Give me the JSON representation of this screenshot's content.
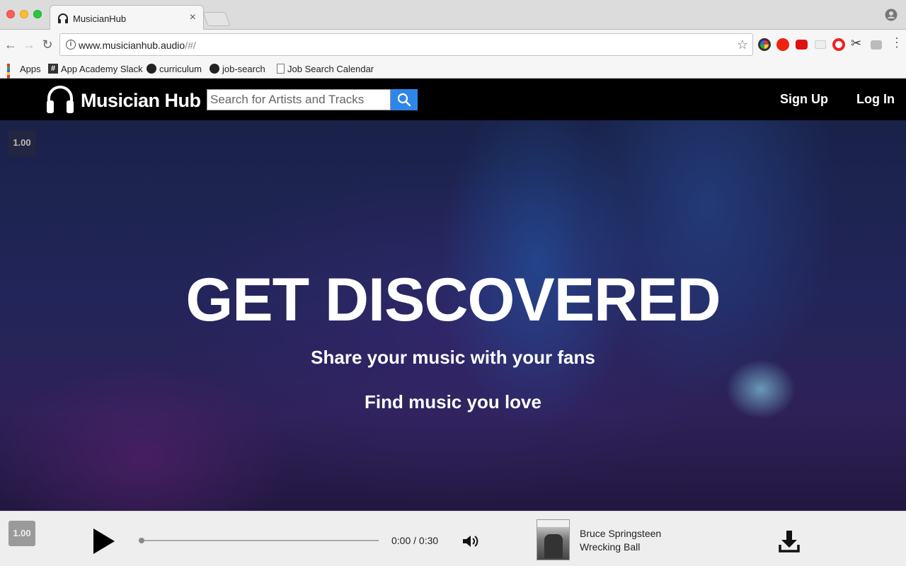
{
  "browser": {
    "tab_title": "MusicianHub",
    "url_main": "www.musicianhub.audio",
    "url_path": "/#/",
    "bookmarks": [
      {
        "label": "Apps",
        "icon": "apps-grid-icon"
      },
      {
        "label": "App Academy Slack",
        "icon": "slack-hash-icon"
      },
      {
        "label": "curriculum",
        "icon": "github-icon"
      },
      {
        "label": "job-search",
        "icon": "github-icon"
      },
      {
        "label": "Job Search Calendar",
        "icon": "document-icon"
      }
    ]
  },
  "site": {
    "logo_text": "Musician Hub",
    "search_placeholder": "Search for Artists and Tracks",
    "nav": {
      "signup": "Sign Up",
      "login": "Log In"
    }
  },
  "hero": {
    "speed_badge": "1.00",
    "title": "GET DISCOVERED",
    "subtitle1": "Share your music with your fans",
    "subtitle2": "Find music you love"
  },
  "player": {
    "speed": "1.00",
    "time": "0:00 / 0:30",
    "progress": 0,
    "artist": "Bruce Springsteen",
    "track": "Wrecking Ball"
  },
  "colors": {
    "accent": "#2f86e9",
    "navbar": "#000000",
    "player_bg": "#eeeeee"
  }
}
